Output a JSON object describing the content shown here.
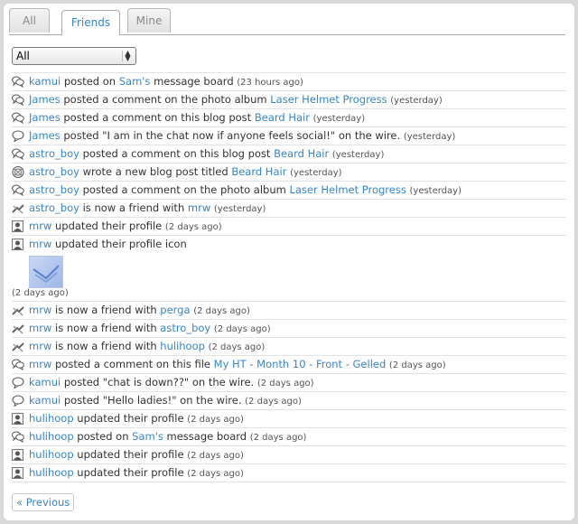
{
  "tabs": [
    {
      "label": "All"
    },
    {
      "label": "Friends"
    },
    {
      "label": "Mine"
    }
  ],
  "filter": {
    "selected": "All"
  },
  "feed": [
    {
      "icon": "comments-icon",
      "parts": [
        {
          "t": "kamui",
          "l": true
        },
        {
          "t": " posted on "
        },
        {
          "t": "Sam's",
          "l": true
        },
        {
          "t": " message board "
        }
      ],
      "time": "(23 hours ago)"
    },
    {
      "icon": "comments-icon",
      "parts": [
        {
          "t": "James",
          "l": true
        },
        {
          "t": " posted a comment on the photo album "
        },
        {
          "t": "Laser Helmet Progress",
          "l": true
        },
        {
          "t": " "
        }
      ],
      "time": "(yesterday)"
    },
    {
      "icon": "comments-icon",
      "parts": [
        {
          "t": "James",
          "l": true
        },
        {
          "t": " posted a comment on this blog post "
        },
        {
          "t": "Beard Hair",
          "l": true
        },
        {
          "t": " "
        }
      ],
      "time": "(yesterday)"
    },
    {
      "icon": "speech-bubble-icon",
      "parts": [
        {
          "t": "James",
          "l": true
        },
        {
          "t": " posted \"I am in the chat now if anyone feels social!\" on the wire. "
        }
      ],
      "time": "(yesterday)"
    },
    {
      "icon": "comments-icon",
      "parts": [
        {
          "t": "astro_boy",
          "l": true
        },
        {
          "t": " posted a comment on this blog post "
        },
        {
          "t": "Beard Hair",
          "l": true
        },
        {
          "t": " "
        }
      ],
      "time": "(yesterday)"
    },
    {
      "icon": "blog-icon",
      "parts": [
        {
          "t": "astro_boy",
          "l": true
        },
        {
          "t": " wrote a new blog post titled "
        },
        {
          "t": "Beard Hair",
          "l": true
        },
        {
          "t": " "
        }
      ],
      "time": "(yesterday)"
    },
    {
      "icon": "comments-icon",
      "parts": [
        {
          "t": "astro_boy",
          "l": true
        },
        {
          "t": " posted a comment on the photo album "
        },
        {
          "t": "Laser Helmet Progress",
          "l": true
        },
        {
          "t": " "
        }
      ],
      "time": "(yesterday)"
    },
    {
      "icon": "friends-icon",
      "parts": [
        {
          "t": "astro_boy",
          "l": true
        },
        {
          "t": " is now a friend with "
        },
        {
          "t": "mrw",
          "l": true
        },
        {
          "t": " "
        }
      ],
      "time": "(yesterday)"
    },
    {
      "icon": "profile-icon",
      "parts": [
        {
          "t": "mrw",
          "l": true
        },
        {
          "t": " updated their profile "
        }
      ],
      "time": "(2 days ago)"
    },
    {
      "icon": "profile-icon",
      "thumb": true,
      "parts": [
        {
          "t": "mrw",
          "l": true
        },
        {
          "t": " updated their profile icon"
        }
      ],
      "time": "(2 days ago)"
    },
    {
      "icon": "friends-icon",
      "parts": [
        {
          "t": "mrw",
          "l": true
        },
        {
          "t": " is now a friend with "
        },
        {
          "t": "perga",
          "l": true
        },
        {
          "t": " "
        }
      ],
      "time": "(2 days ago)"
    },
    {
      "icon": "friends-icon",
      "parts": [
        {
          "t": "mrw",
          "l": true
        },
        {
          "t": " is now a friend with "
        },
        {
          "t": "astro_boy",
          "l": true
        },
        {
          "t": " "
        }
      ],
      "time": "(2 days ago)"
    },
    {
      "icon": "friends-icon",
      "parts": [
        {
          "t": "mrw",
          "l": true
        },
        {
          "t": " is now a friend with "
        },
        {
          "t": "hulihoop",
          "l": true
        },
        {
          "t": " "
        }
      ],
      "time": "(2 days ago)"
    },
    {
      "icon": "comments-icon",
      "parts": [
        {
          "t": "mrw",
          "l": true
        },
        {
          "t": " posted a comment on this file "
        },
        {
          "t": "My HT - Month 10 - Front - Gelled",
          "l": true
        },
        {
          "t": " "
        }
      ],
      "time": "(2 days ago)"
    },
    {
      "icon": "speech-bubble-icon",
      "parts": [
        {
          "t": "kamui",
          "l": true
        },
        {
          "t": " posted \"chat is down??\" on the wire. "
        }
      ],
      "time": "(2 days ago)"
    },
    {
      "icon": "speech-bubble-icon",
      "parts": [
        {
          "t": "kamui",
          "l": true
        },
        {
          "t": " posted \"Hello ladies!\" on the wire. "
        }
      ],
      "time": "(2 days ago)"
    },
    {
      "icon": "profile-icon",
      "parts": [
        {
          "t": "hulihoop",
          "l": true
        },
        {
          "t": " updated their profile "
        }
      ],
      "time": "(2 days ago)"
    },
    {
      "icon": "comments-icon",
      "parts": [
        {
          "t": "hulihoop",
          "l": true
        },
        {
          "t": " posted on "
        },
        {
          "t": "Sam's",
          "l": true
        },
        {
          "t": " message board "
        }
      ],
      "time": "(2 days ago)"
    },
    {
      "icon": "profile-icon",
      "parts": [
        {
          "t": "hulihoop",
          "l": true
        },
        {
          "t": " updated their profile "
        }
      ],
      "time": "(2 days ago)"
    },
    {
      "icon": "profile-icon",
      "parts": [
        {
          "t": "hulihoop",
          "l": true
        },
        {
          "t": " updated their profile "
        }
      ],
      "time": "(2 days ago)"
    }
  ],
  "pagination": {
    "previous_label": "« Previous"
  }
}
